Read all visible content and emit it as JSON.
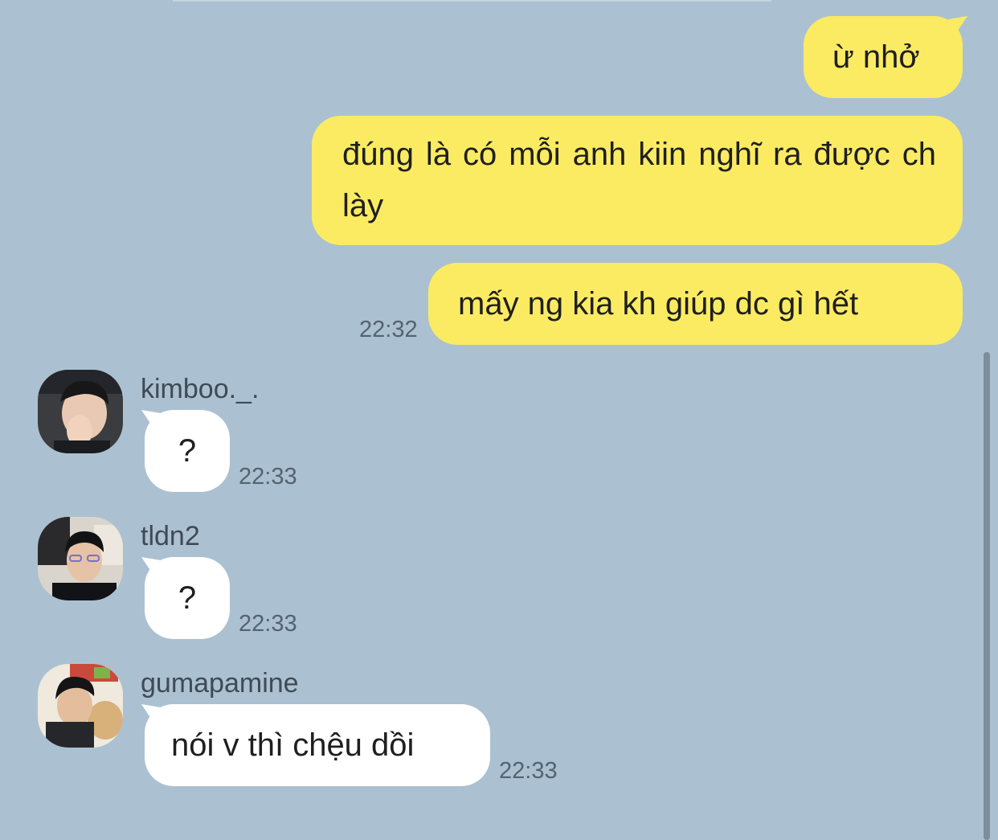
{
  "messages": {
    "m1": {
      "text": "ừ nhở"
    },
    "m2": {
      "text": "đúng là có mỗi anh kiin nghĩ ra được ch lày"
    },
    "m3": {
      "text": "mấy ng kia kh giúp dc gì hết",
      "time": "22:32"
    },
    "m4": {
      "sender": "kimboo._.",
      "avatar": "kimboo-avatar",
      "text": "?",
      "time": "22:33"
    },
    "m5": {
      "sender": "tldn2",
      "avatar": "tldn2-avatar",
      "text": "?",
      "time": "22:33"
    },
    "m6": {
      "sender": "gumapamine",
      "avatar": "gumapamine-avatar",
      "text": "nói v thì chệu dồi",
      "time": "22:33"
    }
  },
  "colors": {
    "background": "#abc1d1",
    "my_bubble": "#fbeb63",
    "their_bubble": "#ffffff"
  }
}
